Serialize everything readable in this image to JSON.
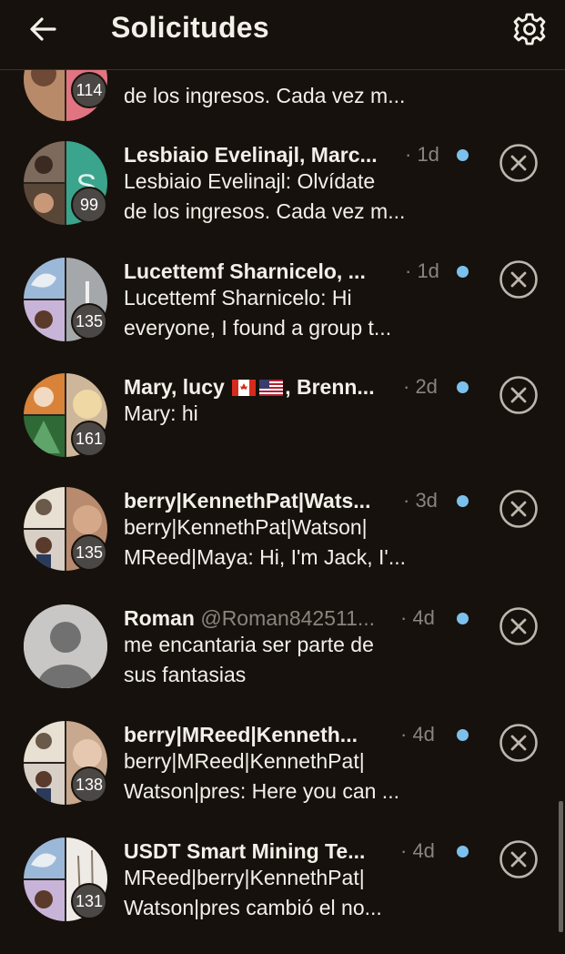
{
  "header": {
    "title": "Solicitudes"
  },
  "rows": [
    {
      "name": "",
      "time": "",
      "line1": "",
      "line2": "de los ingresos. Cada vez m...",
      "count": "114"
    },
    {
      "name": "Lesbiaio Evelinajl, Marc...",
      "time": "· 1d",
      "line1": "Lesbiaio Evelinajl: Olvídate",
      "line2": "de los ingresos. Cada vez m...",
      "count": "99"
    },
    {
      "name": "Lucettemf Sharnicelo, ...",
      "time": "· 1d",
      "line1": "Lucettemf Sharnicelo: Hi",
      "line2": "everyone, I found a group t...",
      "count": "135"
    },
    {
      "name_pre": "Mary, lucy",
      "name_post": ", Brenn...",
      "flags": [
        "canada-flag",
        "usa-flag"
      ],
      "time": "· 2d",
      "line1": "Mary: hi",
      "line2": "",
      "count": "161"
    },
    {
      "name": "berry|KennethPat|Wats...",
      "time": "· 3d",
      "line1": "berry|KennethPat|Watson|",
      "line2": "MReed|Maya: Hi, I'm Jack, I'...",
      "count": "135"
    },
    {
      "name": "Roman",
      "handle": "@Roman842511...",
      "time": "· 4d",
      "line1": "me encantaria ser parte de",
      "line2": "sus fantasias",
      "count": ""
    },
    {
      "name": "berry|MReed|Kenneth...",
      "time": "· 4d",
      "line1": "berry|MReed|KennethPat|",
      "line2": "Watson|pres: Here you can ...",
      "count": "138"
    },
    {
      "name": "USDT Smart Mining Te...",
      "time": "· 4d",
      "line1": "MReed|berry|KennethPat|",
      "line2": "Watson|pres cambió el no...",
      "count": "131"
    }
  ],
  "icons": {
    "back": "arrow-left-icon",
    "settings": "gear-icon",
    "dismiss": "close-circle-icon",
    "unread": "unread-dot"
  },
  "colors": {
    "background": "#16110c",
    "unread": "#7cc0ec",
    "muted": "#8a847e"
  }
}
